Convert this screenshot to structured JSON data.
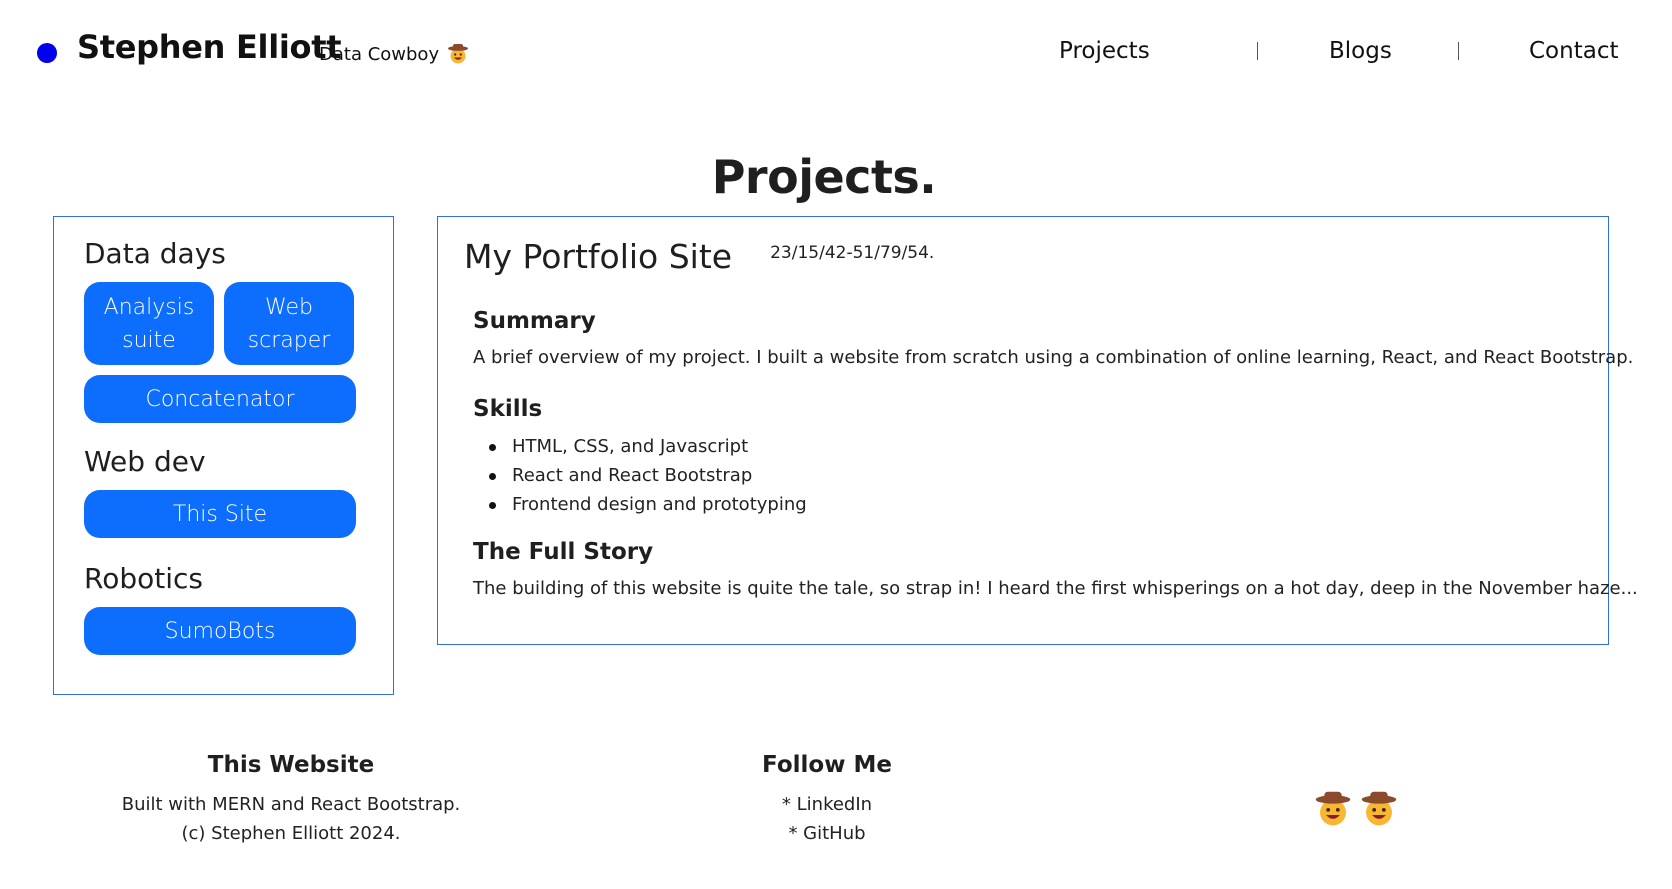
{
  "header": {
    "brand_name": "Stephen Elliott",
    "brand_tag": "Data Cowboy",
    "nav": [
      "Projects",
      "Blogs",
      "Contact"
    ]
  },
  "page": {
    "title": "Projects."
  },
  "sidebar": {
    "groups": [
      {
        "title": "Data days",
        "buttons": [
          "Analysis suite",
          "Web scraper",
          "Concatenator"
        ]
      },
      {
        "title": "Web dev",
        "buttons": [
          "This Site"
        ]
      },
      {
        "title": "Robotics",
        "buttons": [
          "SumoBots"
        ]
      }
    ]
  },
  "project": {
    "title": "My Portfolio Site",
    "date": "23/15/42-51/79/54.",
    "summary_title": "Summary",
    "summary": "A brief overview of my project. I built a website from scratch using a combination of online learning, React, and React Bootstrap.",
    "skills_title": "Skills",
    "skills": [
      "HTML, CSS, and Javascript",
      "React and React Bootstrap",
      "Frontend design and prototyping"
    ],
    "story_title": "The Full Story",
    "story": "The building of this website is quite the tale, so strap in! I heard the first whisperings on a hot day, deep in the November haze..."
  },
  "footer": {
    "website_title": "This Website",
    "website_lines": [
      "Built with MERN and React Bootstrap.",
      "(c) Stephen Elliott 2024."
    ],
    "follow_title": "Follow Me",
    "follow_links": [
      "* LinkedIn",
      "* GitHub"
    ]
  },
  "colors": {
    "accent": "#0d6efd",
    "brand_dot": "#0000ee",
    "border": "#2f6fd6"
  },
  "icons": {
    "brand": "cowboy-face-icon",
    "footer": [
      "cowboy-face-icon",
      "cowboy-face-icon"
    ]
  }
}
